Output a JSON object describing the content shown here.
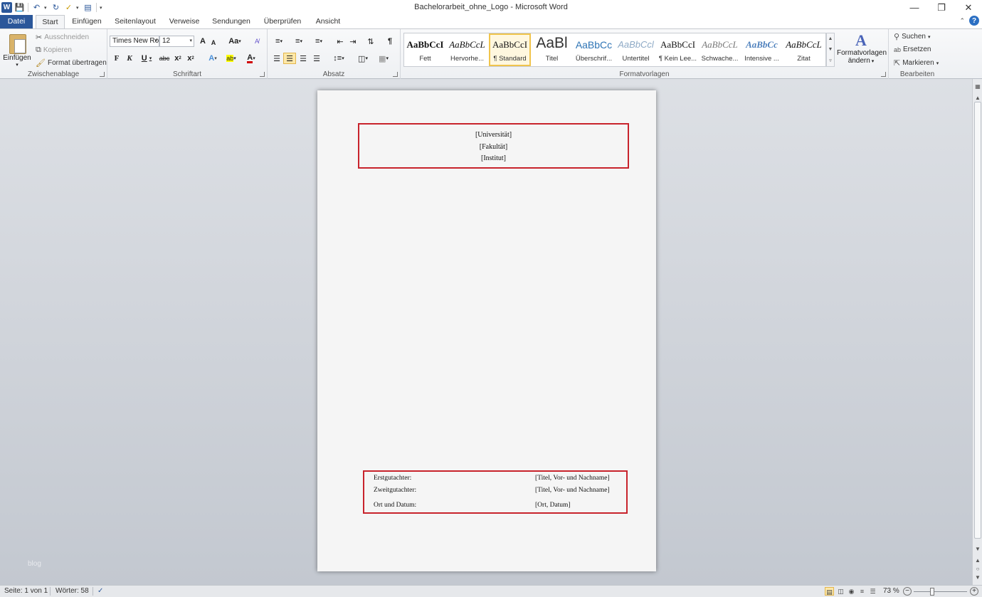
{
  "window": {
    "title": "Bachelorarbeit_ohne_Logo  -  Microsoft Word",
    "minimize_icon": "minimize-icon",
    "restore_icon": "restore-icon",
    "close_icon": "close-icon"
  },
  "quick_access": {
    "app_icon": "W",
    "items": [
      "save-icon",
      "undo-icon",
      "redo-icon",
      "spellcheck-icon",
      "print-preview-icon",
      "customize-icon"
    ]
  },
  "tabs": [
    {
      "label": "Datei"
    },
    {
      "label": "Start"
    },
    {
      "label": "Einfügen"
    },
    {
      "label": "Seitenlayout"
    },
    {
      "label": "Verweise"
    },
    {
      "label": "Sendungen"
    },
    {
      "label": "Überprüfen"
    },
    {
      "label": "Ansicht"
    }
  ],
  "ribbon": {
    "clipboard": {
      "label": "Zwischenablage",
      "paste": "Einfügen",
      "cut": "Ausschneiden",
      "copy": "Kopieren",
      "format_painter": "Format übertragen"
    },
    "font": {
      "label": "Schriftart",
      "font_name": "Times New Ro",
      "font_size": "12",
      "grow": "A",
      "shrink": "A",
      "case": "Aa",
      "bold": "F",
      "italic": "K",
      "underline": "U",
      "strike": "abc",
      "subscript": "x",
      "superscript": "x",
      "effects": "A",
      "highlight": "ab",
      "color": "A"
    },
    "paragraph": {
      "label": "Absatz",
      "pilcrow": "¶"
    },
    "styles": {
      "label": "Formatvorlagen",
      "items": [
        {
          "sample": "AaBbCcI",
          "name": "Fett"
        },
        {
          "sample": "AaBbCcL",
          "name": "Hervorhe..."
        },
        {
          "sample": "AaBbCcI",
          "name": "¶ Standard"
        },
        {
          "sample": "AaBl",
          "name": "Titel"
        },
        {
          "sample": "AaBbCc",
          "name": "Überschrif..."
        },
        {
          "sample": "AaBbCcl",
          "name": "Untertitel"
        },
        {
          "sample": "AaBbCcI",
          "name": "¶ Kein Lee..."
        },
        {
          "sample": "AaBbCcL",
          "name": "Schwache..."
        },
        {
          "sample": "AaBbCc",
          "name": "Intensive ..."
        },
        {
          "sample": "AaBbCcL",
          "name": "Zitat"
        }
      ],
      "change_styles_line1": "Formatvorlagen",
      "change_styles_line2": "ändern"
    },
    "editing": {
      "label": "Bearbeiten",
      "find": "Suchen",
      "replace": "Ersetzen",
      "select": "Markieren"
    }
  },
  "document": {
    "header_lines": [
      "[Universität]",
      "[Fakultät]",
      "[Institut]"
    ],
    "reviewers": [
      {
        "label": "Erstgutachter:",
        "value": "[Titel, Vor- und Nachname]"
      },
      {
        "label": "Zweitgutachter:",
        "value": "[Titel, Vor- und Nachname]"
      },
      {
        "label": "Ort und Datum:",
        "value": "[Ort, Datum]"
      }
    ],
    "highlight_color": "#c8232c",
    "watermark": "blog"
  },
  "status": {
    "page": "Seite: 1 von 1",
    "words": "Wörter: 58",
    "zoom": "73 %"
  }
}
